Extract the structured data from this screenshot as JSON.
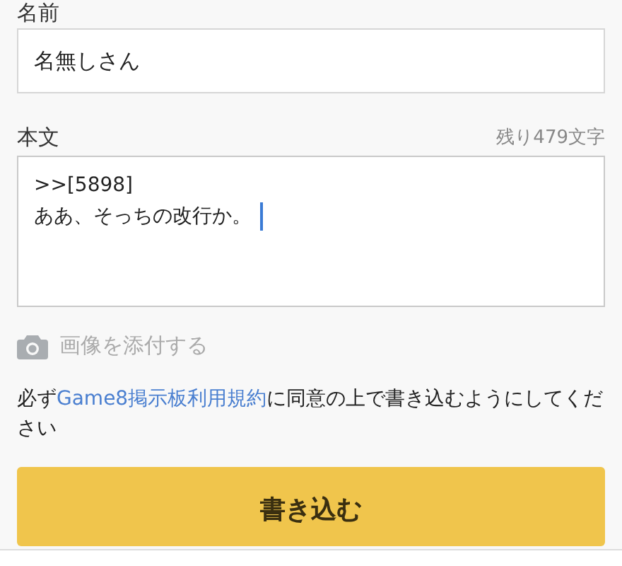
{
  "name_field": {
    "label": "名前",
    "value": "名無しさん"
  },
  "body_field": {
    "label": "本文",
    "counter": "残り479文字",
    "lines": [
      ">>[5898]",
      "ああ、そっちの改行か。"
    ],
    "focused": true
  },
  "attach": {
    "label": "画像を添付する"
  },
  "notice": {
    "before": "必ず",
    "link": "Game8掲示板利用規約",
    "after": "に同意の上で書き込むようにしてください"
  },
  "submit": {
    "label": "書き込む"
  }
}
